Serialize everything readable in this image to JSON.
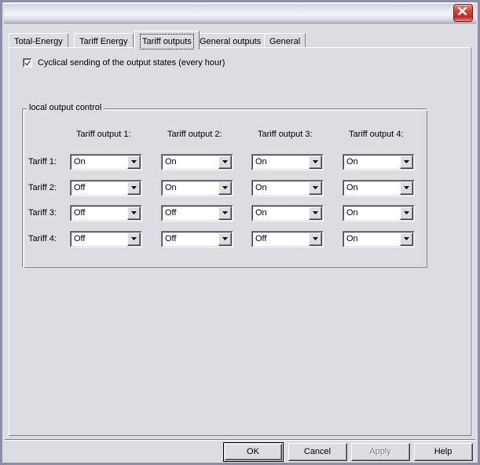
{
  "window": {
    "title": "",
    "close_icon": "close-icon"
  },
  "tabs": [
    {
      "label": "Total-Energy",
      "selected": false
    },
    {
      "label": "Tariff Energy",
      "selected": false
    },
    {
      "label": "Tariff outputs",
      "selected": true
    },
    {
      "label": "General outputs",
      "selected": false
    },
    {
      "label": "General",
      "selected": false
    }
  ],
  "options_checkbox": {
    "label": "Cyclical sending of the output states (every hour)",
    "checked": true
  },
  "group": {
    "legend": "local output control",
    "column_headers": [
      "Tariff output 1:",
      "Tariff output 2:",
      "Tariff output 3:",
      "Tariff output 4:"
    ],
    "row_labels": [
      "Tariff 1:",
      "Tariff 2:",
      "Tariff 3:",
      "Tariff 4:"
    ],
    "dropdown_options": [
      "On",
      "Off"
    ],
    "values": [
      [
        "On",
        "On",
        "On",
        "On"
      ],
      [
        "Off",
        "On",
        "On",
        "On"
      ],
      [
        "Off",
        "Off",
        "On",
        "On"
      ],
      [
        "Off",
        "Off",
        "Off",
        "On"
      ]
    ]
  },
  "buttons": {
    "ok": "OK",
    "cancel": "Cancel",
    "apply": "Apply",
    "help": "Help",
    "apply_disabled": true
  },
  "colors": {
    "dialog_background": "#dcdce1",
    "close_button": "#d8453f",
    "field_background": "#ffffff",
    "disabled_text": "#808080"
  }
}
